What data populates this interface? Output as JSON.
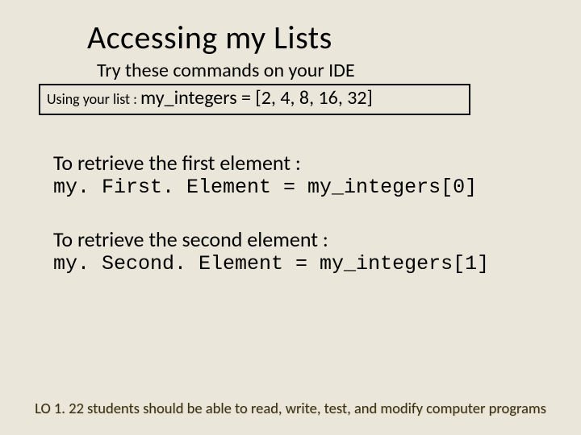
{
  "title": "Accessing my Lists",
  "subtitle": "Try these commands on your IDE",
  "box": {
    "prefix": "Using your list : ",
    "code": "my_integers = [2, 4, 8, 16, 32]"
  },
  "sections": [
    {
      "intro": "To retrieve the first element :",
      "code": "my. First. Element = my_integers[0]"
    },
    {
      "intro": "To retrieve the second element :",
      "code": "my. Second. Element = my_integers[1]"
    }
  ],
  "footer": "LO 1. 22 students should be able to read, write, test, and modify computer programs"
}
